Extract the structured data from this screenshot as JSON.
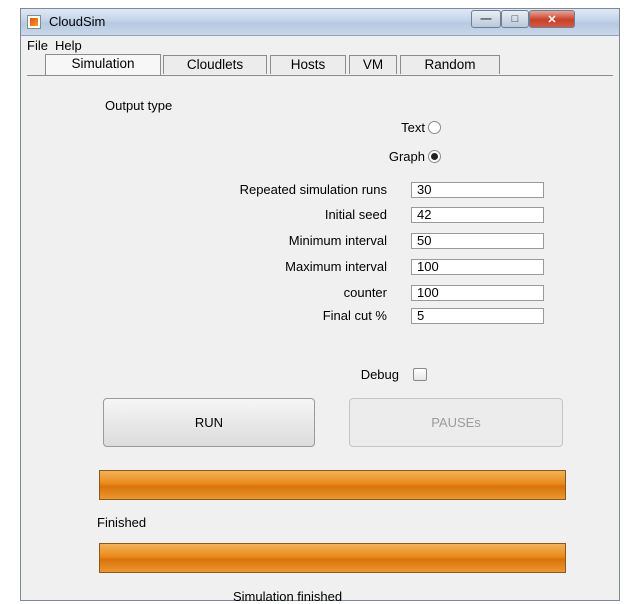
{
  "window": {
    "title": "CloudSim"
  },
  "menu": [
    "File",
    "Help"
  ],
  "tabs": [
    "Simulation",
    "Cloudlets",
    "Hosts",
    "VM",
    "Random"
  ],
  "output": {
    "label": "Output type",
    "options": [
      {
        "label": "Text",
        "selected": false
      },
      {
        "label": "Graph",
        "selected": true
      }
    ]
  },
  "fields": [
    {
      "label": "Repeated simulation runs",
      "value": "30"
    },
    {
      "label": "Initial seed",
      "value": "42"
    },
    {
      "label": "Minimum interval",
      "value": "50"
    },
    {
      "label": "Maximum interval",
      "value": "100"
    },
    {
      "label": "counter",
      "value": "100"
    },
    {
      "label": "Final cut %",
      "value": "5"
    }
  ],
  "debug": {
    "label": "Debug",
    "checked": false
  },
  "buttons": {
    "run": "RUN",
    "pause": "PAUSEs"
  },
  "progress": [
    {
      "percent": 100,
      "status": "Finished"
    },
    {
      "percent": 100,
      "status": "Simulation finished"
    }
  ]
}
